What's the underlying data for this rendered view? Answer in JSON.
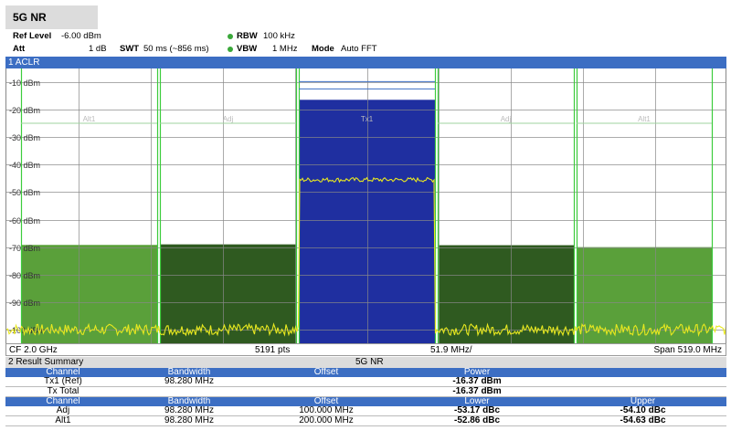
{
  "tab": {
    "title": "5G NR"
  },
  "params": {
    "ref_level_label": "Ref Level",
    "ref_level_value": "-6.00 dBm",
    "att_label": "Att",
    "att_value": "1 dB",
    "swt_label": "SWT",
    "swt_value": "50 ms (~856 ms)",
    "rbw_label": "RBW",
    "rbw_value": "100 kHz",
    "vbw_label": "VBW",
    "vbw_value": "1 MHz",
    "mode_label": "Mode",
    "mode_value": "Auto FFT"
  },
  "window1": {
    "title": "1 ACLR"
  },
  "chart_data": {
    "type": "bar",
    "ylim": [
      -105,
      -5
    ],
    "y_ticks": [
      "-10 dBm",
      "-20 dBm",
      "-30 dBm",
      "-40 dBm",
      "-50 dBm",
      "-60 dBm",
      "-70 dBm",
      "-80 dBm",
      "-90 dBm",
      "-100 dBm"
    ],
    "y_tick_values": [
      -10,
      -20,
      -30,
      -40,
      -50,
      -60,
      -70,
      -80,
      -90,
      -100
    ],
    "channels": [
      {
        "label": "Alt1",
        "power_dbm": -69.2,
        "color": "#5aa03a"
      },
      {
        "label": "Adj",
        "power_dbm": -69.0,
        "color": "#2f5a20"
      },
      {
        "label": "Tx1",
        "power_dbm": -16.4,
        "color": "#1f2fa0"
      },
      {
        "label": "Adj",
        "power_dbm": -69.3,
        "color": "#2f5a20"
      },
      {
        "label": "Alt1",
        "power_dbm": -70.0,
        "color": "#5aa03a"
      }
    ],
    "trace_levels_dbm": [
      -100,
      -100,
      -45.5,
      -100,
      -100
    ],
    "trace_color": "#e8e820"
  },
  "status": {
    "cf": "CF 2.0 GHz",
    "points": "5191 pts",
    "div": "51.9 MHz/",
    "span": "Span 519.0 MHz"
  },
  "summary": {
    "title": "2 Result Summary",
    "standard": "5G NR",
    "head1": [
      "Channel",
      "Bandwidth",
      "Offset",
      "Power",
      ""
    ],
    "rows1": [
      [
        "Tx1 (Ref)",
        "98.280 MHz",
        "",
        "-16.37 dBm",
        ""
      ],
      [
        "Tx Total",
        "",
        "",
        "-16.37 dBm",
        ""
      ]
    ],
    "head2": [
      "Channel",
      "Bandwidth",
      "Offset",
      "Lower",
      "Upper"
    ],
    "rows2": [
      [
        "Adj",
        "98.280 MHz",
        "100.000 MHz",
        "-53.17 dBc",
        "-54.10 dBc"
      ],
      [
        "Alt1",
        "98.280 MHz",
        "200.000 MHz",
        "-52.86 dBc",
        "-54.63 dBc"
      ]
    ]
  }
}
